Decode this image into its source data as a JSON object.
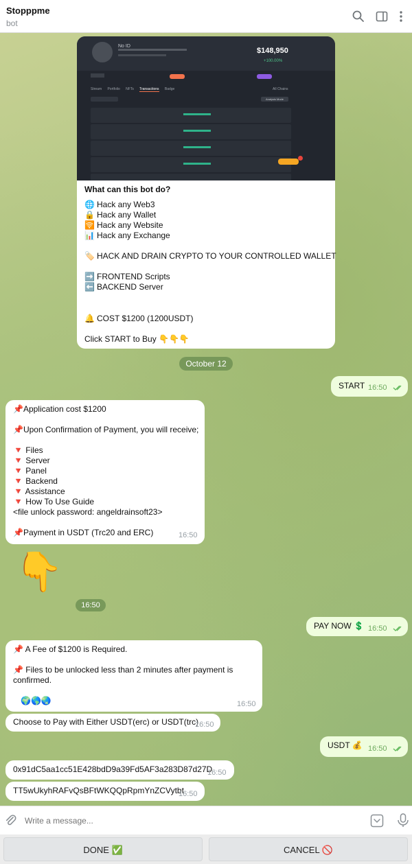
{
  "header": {
    "title": "Stopppme",
    "subtitle": "bot"
  },
  "intro_card": {
    "preview": {
      "name": "No ID",
      "balance": "$148,950",
      "change": "+100.00%",
      "tabs": [
        "Stream",
        "Portfolio",
        "NFTs",
        "Transactions",
        "Badge"
      ],
      "active_tab": "Transactions",
      "button": "Analysis Mode",
      "chain_filter": "All Chains"
    },
    "title": "What can this bot do?",
    "lines": [
      {
        "icon": "🌐",
        "text": "Hack any Web3"
      },
      {
        "icon": "🔒",
        "text": "Hack any Wallet"
      },
      {
        "icon": "🛜",
        "text": "Hack any Website"
      },
      {
        "icon": "📊",
        "text": "Hack any Exchange"
      },
      {
        "icon": "🏷️",
        "text": "HACK AND DRAIN CRYPTO TO YOUR CONTROLLED WALLET"
      },
      {
        "icon": "➡️",
        "text": "FRONTEND Scripts"
      },
      {
        "icon": "⬅️",
        "text": "BACKEND Server"
      },
      {
        "icon": "🔔",
        "text": "COST $1200 (1200USDT)"
      },
      {
        "icon": "",
        "text": "Click START to Buy 👇👇👇"
      }
    ]
  },
  "date_divider": "October 12",
  "messages": [
    {
      "id": "start",
      "text": "START",
      "time": "16:50"
    },
    {
      "id": "info",
      "time": "16:50",
      "lines": [
        "📌Application cost $1200",
        "📌Upon Confirmation of Payment, you will receive;",
        "🔻 Files",
        "🔻 Server",
        "🔻 Panel",
        "🔻 Backend",
        "🔻 Assistance",
        "🔻 How To Use Guide",
        "<file unlock password: angeldrainsoft23>",
        "📌Payment in USDT (Trc20 and ERC)"
      ]
    },
    {
      "id": "sticker",
      "emoji": "👇",
      "time": "16:50"
    },
    {
      "id": "paynow",
      "text": "PAY NOW 💲",
      "time": "16:50"
    },
    {
      "id": "fee",
      "time": "16:50",
      "lines": [
        "📌 A Fee of $1200 is Required.",
        "📌 Files to be unlocked less than 2 minutes after payment is",
        "confirmed.",
        "🌍🌎🌏"
      ]
    },
    {
      "id": "choose",
      "text": "Choose to Pay with Either USDT(erc) or USDT(trc)",
      "time": "16:50"
    },
    {
      "id": "usdt",
      "text": "USDT 💰",
      "time": "16:50"
    },
    {
      "id": "erc",
      "text": "0x91dC5aa1cc51E428bdD9a39Fd5AF3a283D87d27D",
      "time": "16:50"
    },
    {
      "id": "trc",
      "text": "TT5wUkyhRAFvQsBFtWKQQpRpmYnZCVytbt",
      "time": "16:50"
    }
  ],
  "composer": {
    "placeholder": "Write a message..."
  },
  "keyboard": {
    "done": "DONE ✅",
    "cancel": "CANCEL 🚫"
  }
}
